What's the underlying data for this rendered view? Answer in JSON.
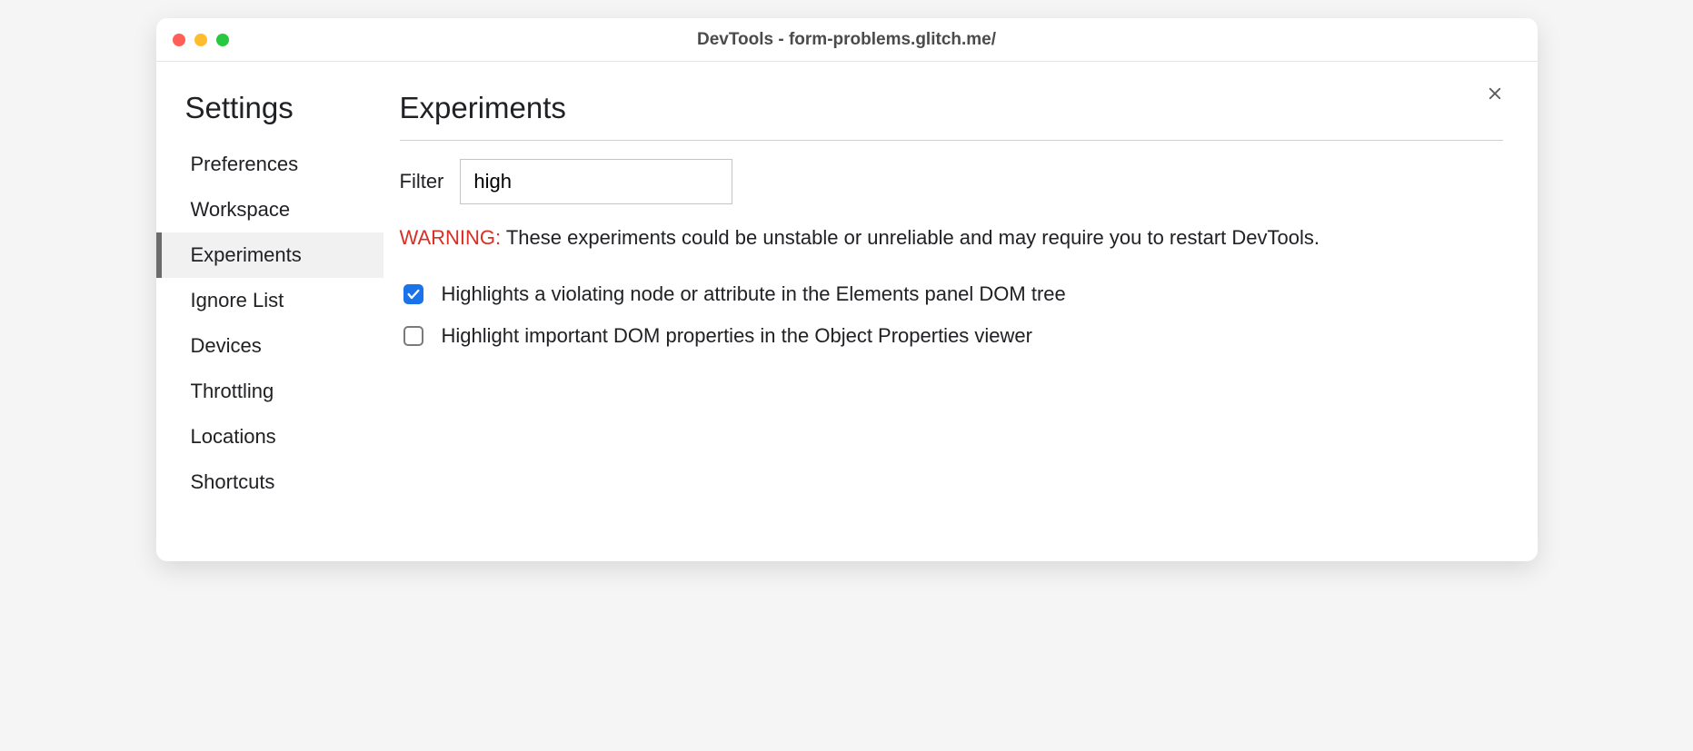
{
  "window": {
    "title": "DevTools - form-problems.glitch.me/"
  },
  "sidebar": {
    "title": "Settings",
    "items": [
      {
        "label": "Preferences",
        "active": false
      },
      {
        "label": "Workspace",
        "active": false
      },
      {
        "label": "Experiments",
        "active": true
      },
      {
        "label": "Ignore List",
        "active": false
      },
      {
        "label": "Devices",
        "active": false
      },
      {
        "label": "Throttling",
        "active": false
      },
      {
        "label": "Locations",
        "active": false
      },
      {
        "label": "Shortcuts",
        "active": false
      }
    ]
  },
  "main": {
    "title": "Experiments",
    "filter_label": "Filter",
    "filter_value": "high",
    "warning_label": "WARNING:",
    "warning_text": " These experiments could be unstable or unreliable and may require you to restart DevTools.",
    "experiments": [
      {
        "label": "Highlights a violating node or attribute in the Elements panel DOM tree",
        "checked": true
      },
      {
        "label": "Highlight important DOM properties in the Object Properties viewer",
        "checked": false
      }
    ]
  }
}
